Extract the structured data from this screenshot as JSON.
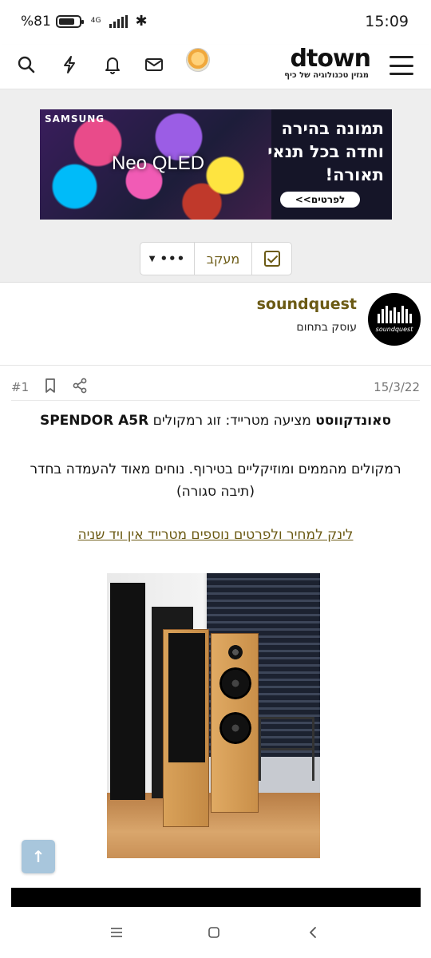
{
  "status_bar": {
    "battery_percent": "81",
    "battery_level": 0.81,
    "network": "4G",
    "time": "15:09"
  },
  "header": {
    "icons": [
      "search-icon",
      "lightning-icon",
      "bell-icon",
      "mail-icon"
    ],
    "logo_main": "dtown",
    "logo_tagline": "מגזין טכנולוגיה של כיף",
    "menu_icon": "hamburger-menu-icon"
  },
  "ad": {
    "brand": "SAMSUNG",
    "product": "Neo QLED",
    "headline": "תמונה בהירה וחדה בכל תנאי תאורה!",
    "cta": "לפרטים>>"
  },
  "thread_actions": {
    "more_label": "•••",
    "follow_label": "מעקב"
  },
  "user": {
    "username": "soundquest",
    "title": "עוסק בתחום",
    "avatar_text": "soundquest"
  },
  "post": {
    "date": "15/3/22",
    "number": "#1",
    "title_bold": "סאונדקווסט",
    "title_rest": " מציעה מטרייד: זוג רמקולים ",
    "title_brand": "SPENDOR A5R",
    "description": "רמקולים מהממים ומוזיקליים בטירוף. נוחים מאוד להעמדה בחדר (תיבה סגורה)",
    "link_text": "לינק למחיר ולפרטים נוספים מטרייד אין ויד שניה"
  },
  "colors": {
    "accent": "#6b5a14",
    "scroll_button": "#a8c6dc",
    "grey_background": "#eeeeee"
  }
}
